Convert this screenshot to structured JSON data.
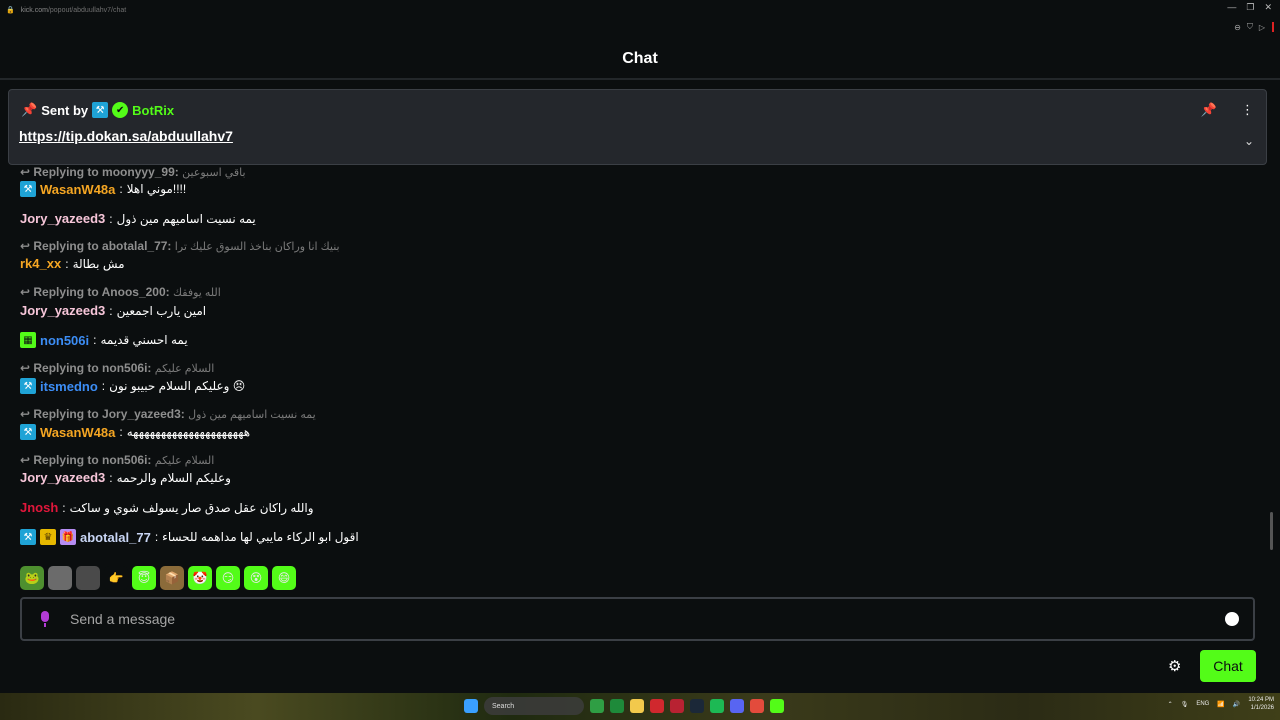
{
  "browser": {
    "url_domain": "kick.com",
    "url_path": "/popout/abduullahv7/chat"
  },
  "header": {
    "title": "Chat"
  },
  "pinned": {
    "sent_by_label": "Sent by",
    "sender": "BotRix",
    "sender_color": "#53fc18",
    "link": "https://tip.dokan.sa/abduullahv7"
  },
  "messages": [
    {
      "type": "reply",
      "reply_to": "Replying to moonyyy_99:",
      "reply_text": "باقي اسبوعين"
    },
    {
      "type": "msg",
      "user": "WasanW48a",
      "color": "#f5a623",
      "badges": [
        "mod"
      ],
      "text": "موني اهلا!!!!"
    },
    {
      "type": "msg",
      "user": "Jory_yazeed3",
      "color": "#f7c6d9",
      "badges": [],
      "text": "يمه نسيت اساميهم مين ذول"
    },
    {
      "type": "reply",
      "reply_to": "Replying to abotalal_77:",
      "reply_text": "بنيك انا وراكان بناخذ السوق عليك ترا"
    },
    {
      "type": "msg",
      "user": "rk4_xx",
      "color": "#f5a623",
      "badges": [],
      "text": "مش بطالة"
    },
    {
      "type": "reply",
      "reply_to": "Replying to Anoos_200:",
      "reply_text": "الله يوفقك"
    },
    {
      "type": "msg",
      "user": "Jory_yazeed3",
      "color": "#f7c6d9",
      "badges": [],
      "text": "امين يارب اجمعين"
    },
    {
      "type": "msg",
      "user": "non506i",
      "color": "#3c8df5",
      "badges": [
        "sub"
      ],
      "text": "يمه احسني قديمه"
    },
    {
      "type": "reply",
      "reply_to": "Replying to non506i:",
      "reply_text": "السلام عليكم"
    },
    {
      "type": "msg",
      "user": "itsmedno",
      "color": "#3c8df5",
      "badges": [
        "mod"
      ],
      "text": "وعليكم السلام حبيبو نون 😣"
    },
    {
      "type": "reply",
      "reply_to": "Replying to Jory_yazeed3:",
      "reply_text": "يمه نسيت اساميهم مين ذول"
    },
    {
      "type": "msg",
      "user": "WasanW48a",
      "color": "#f5a623",
      "badges": [
        "mod"
      ],
      "text": "هههههههههههههههههههههه"
    },
    {
      "type": "reply",
      "reply_to": "Replying to non506i:",
      "reply_text": "السلام عليكم"
    },
    {
      "type": "msg",
      "user": "Jory_yazeed3",
      "color": "#f7c6d9",
      "badges": [],
      "text": "وعليكم السلام والرحمه"
    },
    {
      "type": "msg",
      "user": "Jnosh",
      "color": "#e0173b",
      "badges": [],
      "text": "والله راكان عقل صدق صار يسولف شوي و ساكت"
    },
    {
      "type": "msg",
      "user": "abotalal_77",
      "color": "#c9d6f5",
      "badges": [
        "mod",
        "crown",
        "gift"
      ],
      "text": "اقول ابو الركاء مايبي لها مداهمه للحساء"
    }
  ],
  "emotes": [
    "frog",
    "photo1",
    "photo2",
    "hand",
    "angel",
    "box",
    "clown",
    "kick1",
    "kick2",
    "kick3"
  ],
  "input": {
    "placeholder": "Send a message"
  },
  "chat_button": {
    "label": "Chat"
  },
  "taskbar": {
    "search_label": "Search",
    "lang": "ENG",
    "time": "10:24 PM",
    "date": "1/1/2026"
  },
  "colors": {
    "accent": "#53fc18",
    "background": "#0b0e0f",
    "pinned_bg": "#24272c"
  }
}
